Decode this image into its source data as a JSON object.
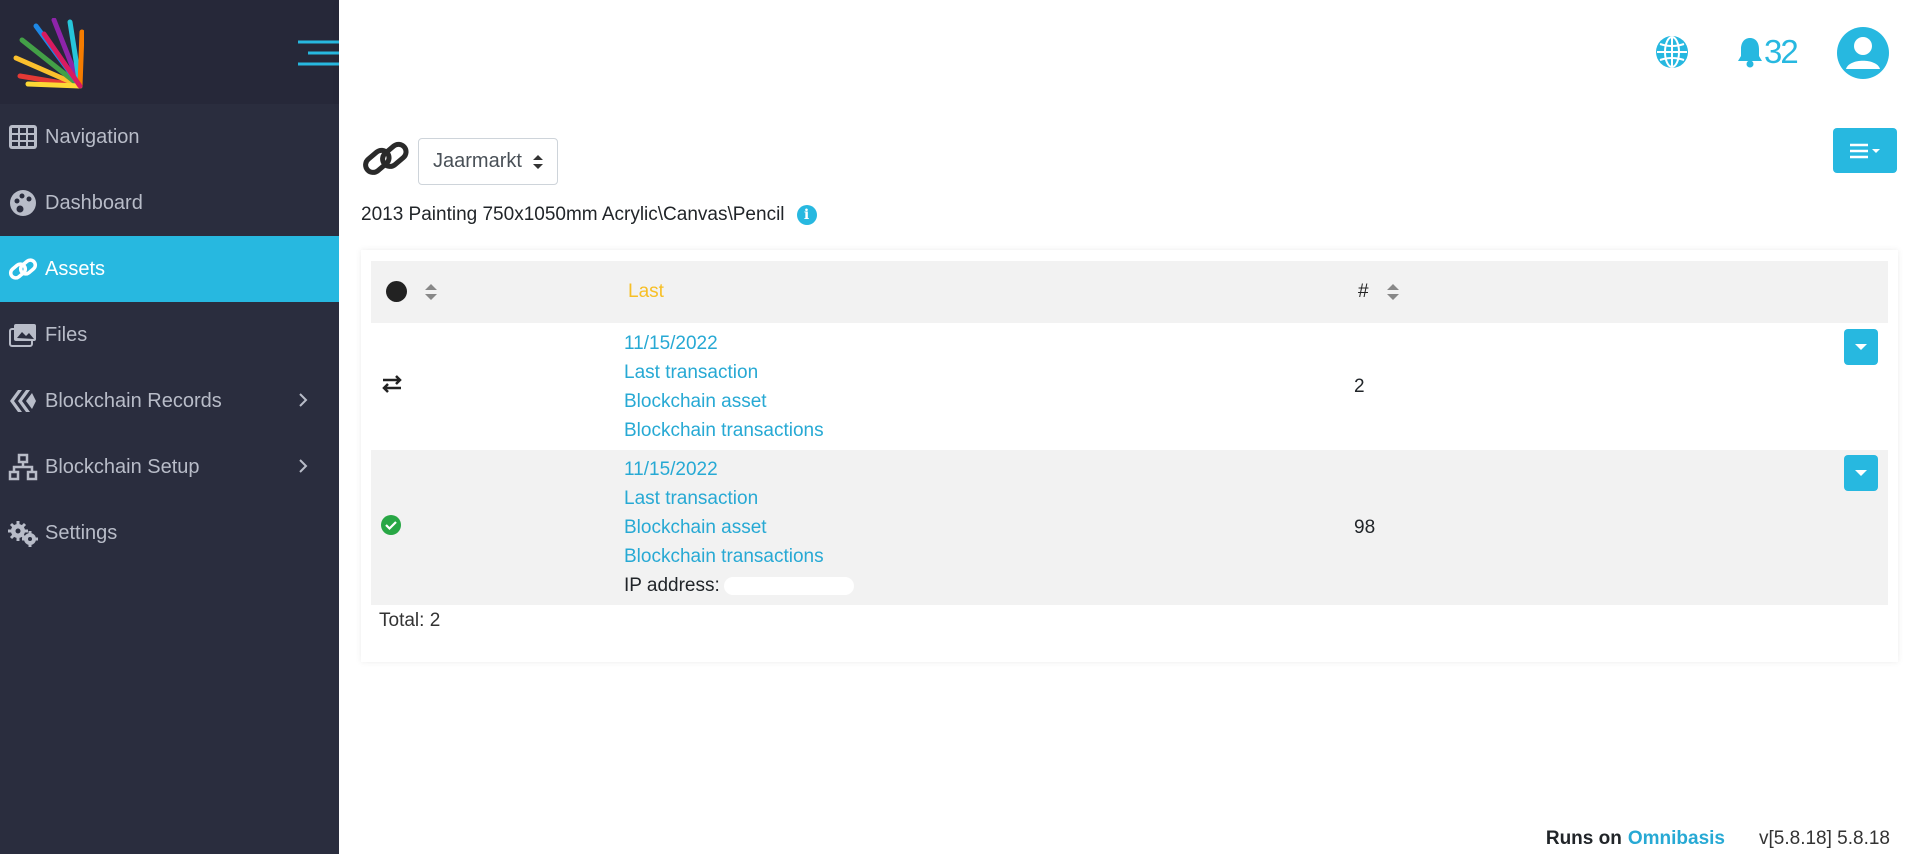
{
  "colors": {
    "accent": "#27b8e0",
    "sidebar_bg": "#2a2d3e",
    "sort_active": "#f7bf26",
    "success": "#28a745"
  },
  "sidebar": {
    "items": [
      {
        "label": "Navigation",
        "icon": "grid-icon",
        "active": false
      },
      {
        "label": "Dashboard",
        "icon": "palette-icon",
        "active": false
      },
      {
        "label": "Assets",
        "icon": "link-icon",
        "active": true
      },
      {
        "label": "Files",
        "icon": "images-icon",
        "active": false
      },
      {
        "label": "Blockchain Records",
        "icon": "blockchain-icon",
        "active": false,
        "has_submenu": true
      },
      {
        "label": "Blockchain Setup",
        "icon": "network-icon",
        "active": false,
        "has_submenu": true
      },
      {
        "label": "Settings",
        "icon": "gears-icon",
        "active": false
      }
    ]
  },
  "topbar": {
    "notifications_count": "32"
  },
  "main": {
    "selector_value": "Jaarmarkt",
    "subtitle": "2013 Painting 750x1050mm Acrylic\\Canvas\\Pencil",
    "table": {
      "headers": {
        "last": "Last",
        "num": "#"
      },
      "rows": [
        {
          "status_icon": "exchange-icon",
          "date": "11/15/2022",
          "links": [
            "Last transaction",
            "Blockchain asset",
            "Blockchain transactions"
          ],
          "count": "2"
        },
        {
          "status_icon": "check-circle-icon",
          "date": "11/15/2022",
          "links": [
            "Last transaction",
            "Blockchain asset",
            "Blockchain transactions"
          ],
          "ip_label": "IP address:",
          "count": "98"
        }
      ],
      "total": "Total: 2"
    }
  },
  "footer": {
    "runs_on": "Runs on",
    "brand": "Omnibasis",
    "version": "v[5.8.18] 5.8.18"
  }
}
